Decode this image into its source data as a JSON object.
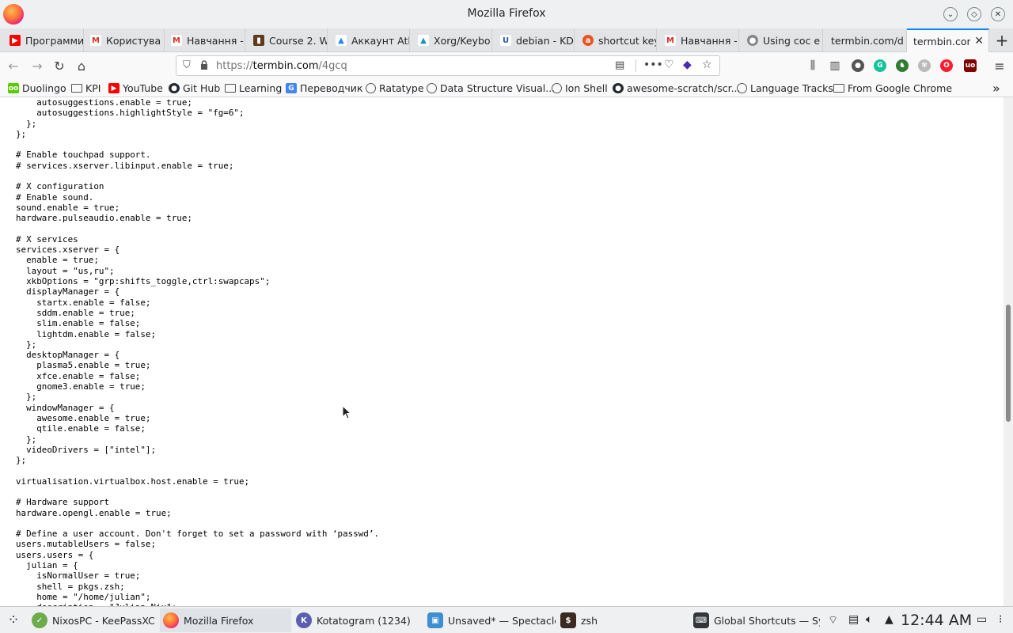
{
  "window": {
    "title": "Mozilla Firefox",
    "controls": [
      "minimize",
      "maximize",
      "close"
    ]
  },
  "tabs": [
    {
      "label": "Программи",
      "icon": "youtube-icon",
      "color": "#ff0000",
      "glyph": "▶"
    },
    {
      "label": "Користува",
      "icon": "gmail-icon",
      "color": "#d93025",
      "glyph": "M"
    },
    {
      "label": "Навчання -",
      "icon": "gmail-icon",
      "color": "#d93025",
      "glyph": "M"
    },
    {
      "label": "Course 2. W",
      "icon": "trello-icon",
      "color": "#5e3a1f",
      "glyph": "▮"
    },
    {
      "label": "Аккаунт Atl",
      "icon": "atlassian-icon",
      "color": "#2684ff",
      "glyph": "▲"
    },
    {
      "label": "Xorg/Keybo",
      "icon": "arch-icon",
      "color": "#1793d1",
      "glyph": "▲"
    },
    {
      "label": "debian - KD",
      "icon": "unix-se-icon",
      "color": "#2c55a5",
      "glyph": "U"
    },
    {
      "label": "shortcut key",
      "icon": "askubuntu-icon",
      "color": "#e95420",
      "glyph": "a"
    },
    {
      "label": "Навчання -",
      "icon": "gmail-icon",
      "color": "#d93025",
      "glyph": "M"
    },
    {
      "label": "Using coc e",
      "icon": "github-icon",
      "color": "#24292e",
      "glyph": "●"
    },
    {
      "label": "termbin.com/d",
      "icon": "blank-page-icon",
      "color": "#ffffff",
      "glyph": ""
    },
    {
      "label": "termbin.com",
      "icon": "blank-page-icon",
      "color": "#ffffff",
      "glyph": "",
      "active": true
    }
  ],
  "nav": {
    "url_prefix": "https://",
    "url_host": "termbin.com",
    "url_path": "/4gcq"
  },
  "bookmarks": [
    {
      "label": "Duolingo",
      "icon": "duolingo-icon",
      "color": "#58cc02"
    },
    {
      "label": "KPI",
      "icon": "folder-icon",
      "color": ""
    },
    {
      "label": "YouTube",
      "icon": "youtube-icon",
      "color": "#ff0000"
    },
    {
      "label": "Git Hub",
      "icon": "github-icon",
      "color": "#24292e"
    },
    {
      "label": "Learning",
      "icon": "folder-icon",
      "color": ""
    },
    {
      "label": "Переводчик",
      "icon": "translate-icon",
      "color": "#4285f4"
    },
    {
      "label": "Ratatype",
      "icon": "globe-icon",
      "color": ""
    },
    {
      "label": "Data Structure Visual...",
      "icon": "globe-icon",
      "color": ""
    },
    {
      "label": "Ion Shell",
      "icon": "globe-icon",
      "color": ""
    },
    {
      "label": "awesome-scratch/scr...",
      "icon": "github-icon",
      "color": "#24292e"
    },
    {
      "label": "Language Tracks",
      "icon": "globe-icon",
      "color": ""
    },
    {
      "label": "From Google Chrome",
      "icon": "folder-icon",
      "color": ""
    }
  ],
  "code_lines": [
    "    autosuggestions.enable = true;",
    "    autosuggestions.highlightStyle = \"fg=6\";",
    "  };",
    "};",
    "",
    "# Enable touchpad support.",
    "# services.xserver.libinput.enable = true;",
    "",
    "# X configuration",
    "# Enable sound.",
    "sound.enable = true;",
    "hardware.pulseaudio.enable = true;",
    "",
    "# X services",
    "services.xserver = {",
    "  enable = true;",
    "  layout = \"us,ru\";",
    "  xkbOptions = \"grp:shifts_toggle,ctrl:swapcaps\";",
    "  displayManager = {",
    "    startx.enable = false;",
    "    sddm.enable = true;",
    "    slim.enable = false;",
    "    lightdm.enable = false;",
    "  };",
    "  desktopManager = {",
    "    plasma5.enable = true;",
    "    xfce.enable = false;",
    "    gnome3.enable = true;",
    "  };",
    "  windowManager = {",
    "    awesome.enable = true;",
    "    qtile.enable = false;",
    "  };",
    "  videoDrivers = [\"intel\"];",
    "};",
    "",
    "virtualisation.virtualbox.host.enable = true;",
    "",
    "# Hardware support",
    "hardware.opengl.enable = true;",
    "",
    "# Define a user account. Don't forget to set a password with ‘passwd’.",
    "users.mutableUsers = false;",
    "users.users = {",
    "  julian = {",
    "    isNormalUser = true;",
    "    shell = pkgs.zsh;",
    "    home = \"/home/julian\";",
    "    description = \"Julian Nix\";"
  ],
  "taskbar": {
    "tasks": [
      {
        "label": "NixosPC - KeePassXC",
        "icon": "keepassxc-icon",
        "color": "#6cac4d"
      },
      {
        "label": "Mozilla Firefox",
        "icon": "firefox-icon",
        "color": "#ff7139",
        "active": true
      },
      {
        "label": "Kotatogram (1234)",
        "icon": "kotatogram-icon",
        "color": "#5a5fb0"
      },
      {
        "label": "Unsaved* — Spectacle",
        "icon": "spectacle-icon",
        "color": "#3d8fd1"
      },
      {
        "label": "zsh",
        "icon": "terminal-icon",
        "color": "#3a2a22"
      },
      {
        "label": "Global Shortcuts — Sy...",
        "icon": "settings-icon",
        "color": "#31363b"
      }
    ],
    "clock": "12:44 AM"
  }
}
